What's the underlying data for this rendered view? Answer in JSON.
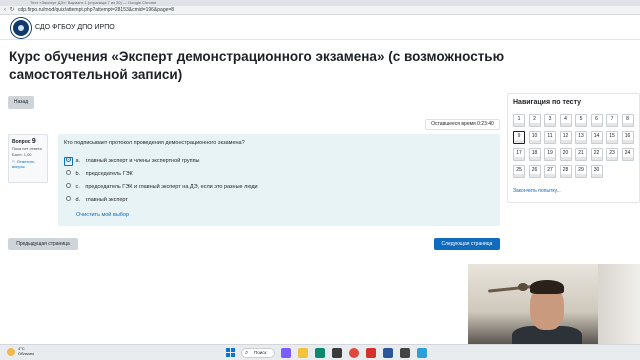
{
  "browser": {
    "tab_text": "Тест «Эксперт ДЭ»: Вариант 1 (страница 7 из 30) — Google Chrome",
    "url": "cdp.firpo.ru/mod/quiz/attempt.php?attempt=28153&cmid=196&page=8"
  },
  "header": {
    "site_name": "СДО ФГБОУ ДПО ИРПО"
  },
  "page": {
    "course_title": "Курс обучения «Эксперт демонстрационного экзамена» (с возможностью самостоятельной записи)",
    "back_label": "Назад",
    "timer": "Оставшееся время 0:23:40"
  },
  "question": {
    "label": "Вопрос",
    "number": "9",
    "status": "Пока нет ответа",
    "points": "Балл: 1,00",
    "flag_label": "Отметить вопрос",
    "text": "Кто подписывает протокол проведения демонстрационного экзамена?",
    "answers": [
      {
        "letter": "a.",
        "text": "главный эксперт и члены экспертной группы"
      },
      {
        "letter": "b.",
        "text": "председатель ГЭК"
      },
      {
        "letter": "c.",
        "text": "председатель ГЭК и главный эксперт на ДЭ, если это разные люди"
      },
      {
        "letter": "d.",
        "text": "главный эксперт"
      }
    ],
    "clear_label": "Очистить мой выбор"
  },
  "footer_nav": {
    "prev_label": "Предыдущая страница",
    "next_label": "Следующая страница"
  },
  "navigation": {
    "title": "Навигация по тесту",
    "cells": [
      "1",
      "2",
      "3",
      "4",
      "5",
      "6",
      "7",
      "8",
      "9",
      "10",
      "11",
      "12",
      "13",
      "14",
      "15",
      "16",
      "17",
      "18",
      "19",
      "20",
      "21",
      "22",
      "23",
      "24",
      "25",
      "26",
      "27",
      "28",
      "29",
      "30"
    ],
    "finish_label": "Закончить попытку..."
  },
  "taskbar": {
    "temperature": "4°C",
    "weather_text": "Облачно",
    "search_label": "Поиск"
  },
  "colors": {
    "accent": "#0f6cbf",
    "question_bg": "#e7f3f5",
    "button_gray": "#ced4da"
  }
}
